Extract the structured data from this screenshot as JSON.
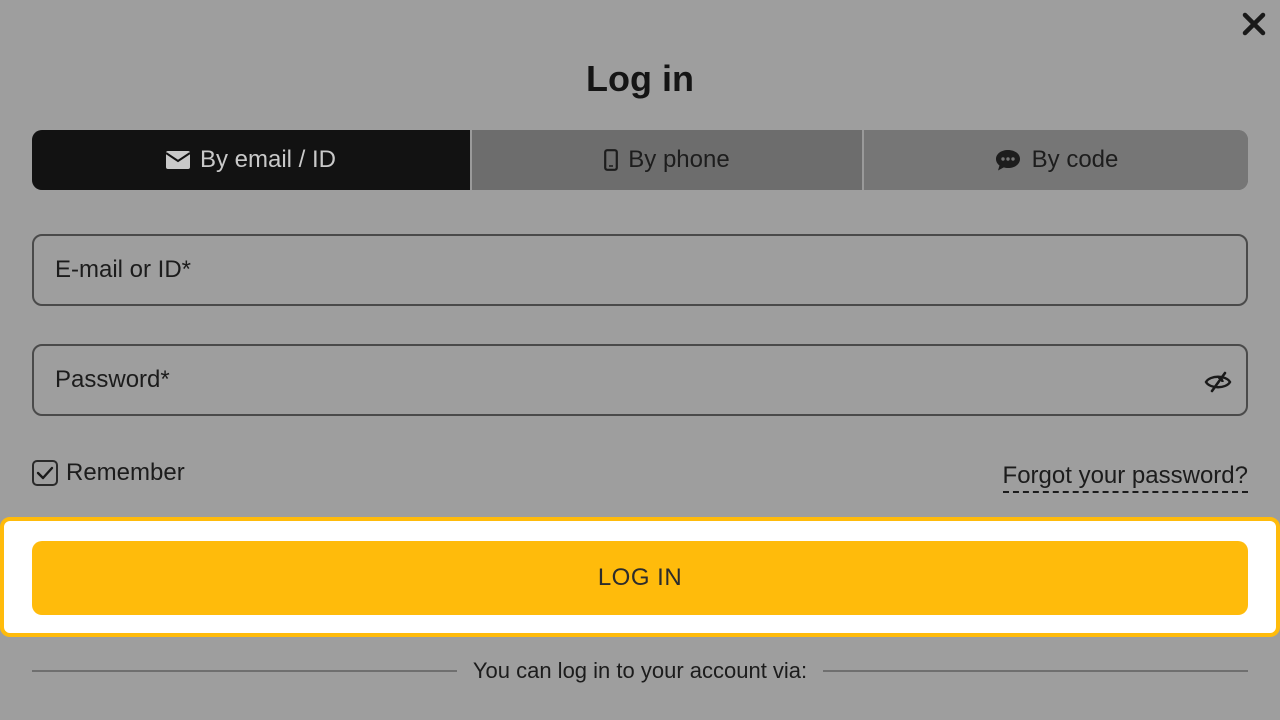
{
  "modal": {
    "title": "Log in"
  },
  "tabs": [
    {
      "label": "By email / ID",
      "icon": "envelope-icon",
      "active": true
    },
    {
      "label": "By phone",
      "icon": "mobile-phone-icon",
      "active": false
    },
    {
      "label": "By code",
      "icon": "chat-bubble-icon",
      "active": false
    }
  ],
  "form": {
    "email_placeholder": "E-mail or ID*",
    "email_value": "",
    "password_placeholder": "Password*",
    "password_value": "",
    "remember_label": "Remember",
    "remember_checked": true,
    "forgot_label": "Forgot your password?",
    "submit_label": "LOG IN"
  },
  "alternatives": {
    "divider_text": "You can log in to your account via:"
  },
  "colors": {
    "accent": "#ffbb0b",
    "backdrop": "#9e9e9e",
    "active_tab": "#121212"
  }
}
